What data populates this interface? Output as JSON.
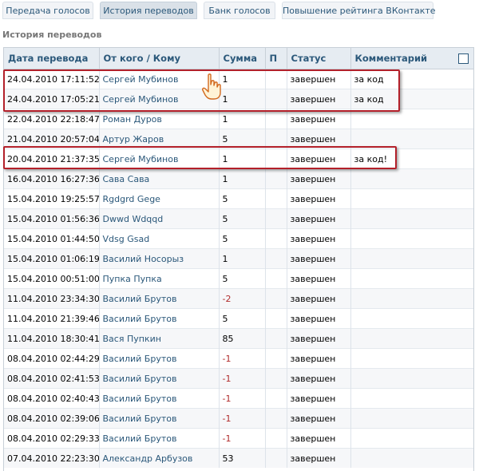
{
  "tabs": [
    {
      "label": "Передача голосов",
      "active": false
    },
    {
      "label": "История переводов",
      "active": true
    },
    {
      "label": "Банк голосов",
      "active": false
    },
    {
      "label": "Повышение рейтинга ВКонтакте",
      "active": false
    }
  ],
  "section_title": "История переводов",
  "table": {
    "headers": [
      "Дата перевода",
      "От кого / Кому",
      "Сумма",
      "П",
      "Статус",
      "Комментарий"
    ],
    "rows": [
      {
        "date": "24.04.2010 17:11:52",
        "user": "Сергей Мубинов",
        "amount": "1",
        "p": "",
        "status": "завершен",
        "comment": "за код"
      },
      {
        "date": "24.04.2010 17:05:21",
        "user": "Сергей Мубинов",
        "amount": "1",
        "p": "",
        "status": "завершен",
        "comment": "за код"
      },
      {
        "date": "22.04.2010 22:18:47",
        "user": "Роман Дуров",
        "amount": "1",
        "p": "",
        "status": "завершен",
        "comment": ""
      },
      {
        "date": "21.04.2010 20:57:04",
        "user": "Артур Жаров",
        "amount": "5",
        "p": "",
        "status": "завершен",
        "comment": ""
      },
      {
        "date": "20.04.2010 21:37:35",
        "user": "Сергей Мубинов",
        "amount": "1",
        "p": "",
        "status": "завершен",
        "comment": "за код!"
      },
      {
        "date": "16.04.2010 16:27:36",
        "user": "Сава Сава",
        "amount": "1",
        "p": "",
        "status": "завершен",
        "comment": ""
      },
      {
        "date": "15.04.2010 19:25:57",
        "user": "Rgdgrd Gege",
        "amount": "5",
        "p": "",
        "status": "завершен",
        "comment": ""
      },
      {
        "date": "15.04.2010 01:56:36",
        "user": "Dwwd Wdqqd",
        "amount": "5",
        "p": "",
        "status": "завершен",
        "comment": ""
      },
      {
        "date": "15.04.2010 01:44:50",
        "user": "Vdsg Gsad",
        "amount": "5",
        "p": "",
        "status": "завершен",
        "comment": ""
      },
      {
        "date": "15.04.2010 01:06:19",
        "user": "Василий Носорыз",
        "amount": "1",
        "p": "",
        "status": "завершен",
        "comment": ""
      },
      {
        "date": "15.04.2010 00:51:00",
        "user": "Пупка Пупка",
        "amount": "5",
        "p": "",
        "status": "завершен",
        "comment": ""
      },
      {
        "date": "11.04.2010 23:34:30",
        "user": "Василий Брутов",
        "amount": "-2",
        "p": "",
        "status": "завершен",
        "comment": ""
      },
      {
        "date": "11.04.2010 21:39:46",
        "user": "Василий Брутов",
        "amount": "5",
        "p": "",
        "status": "завершен",
        "comment": ""
      },
      {
        "date": "11.04.2010 18:30:41",
        "user": "Вася Пупкин",
        "amount": "85",
        "p": "",
        "status": "завершен",
        "comment": ""
      },
      {
        "date": "08.04.2010 02:44:29",
        "user": "Василий Брутов",
        "amount": "-1",
        "p": "",
        "status": "завершен",
        "comment": ""
      },
      {
        "date": "08.04.2010 02:41:53",
        "user": "Василий Брутов",
        "amount": "-1",
        "p": "",
        "status": "завершен",
        "comment": ""
      },
      {
        "date": "08.04.2010 02:40:43",
        "user": "Василий Брутов",
        "amount": "-1",
        "p": "",
        "status": "завершен",
        "comment": ""
      },
      {
        "date": "08.04.2010 02:39:06",
        "user": "Василий Брутов",
        "amount": "-1",
        "p": "",
        "status": "завершен",
        "comment": ""
      },
      {
        "date": "08.04.2010 02:29:33",
        "user": "Василий Брутов",
        "amount": "-1",
        "p": "",
        "status": "завершен",
        "comment": ""
      },
      {
        "date": "07.04.2010 22:23:30",
        "user": "Александр Арбузов",
        "amount": "53",
        "p": "",
        "status": "завершен",
        "comment": ""
      }
    ]
  },
  "colors": {
    "link": "#2b587a",
    "header_bg": "#e6ecf2",
    "negative": "#b02a2a",
    "highlight": "#b3202a"
  },
  "icons": {
    "cursor": "hand-pointer-icon",
    "select_all": "checkbox-icon"
  }
}
